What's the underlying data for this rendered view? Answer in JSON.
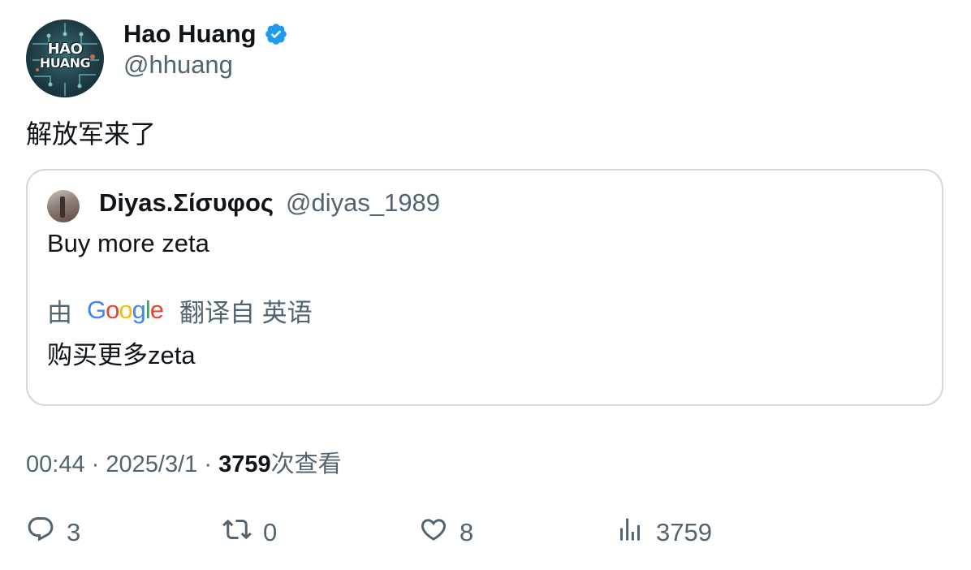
{
  "author": {
    "display_name": "Hao Huang",
    "handle": "@hhuang",
    "avatar_text": [
      "HAO",
      "HUANG"
    ],
    "verified": true
  },
  "tweet": {
    "text": "解放军来了"
  },
  "quoted_tweet": {
    "display_name": "Diyas.Σίσυφος",
    "handle": "@diyas_1989",
    "text": "Buy more zeta",
    "translation": {
      "prefix": "由",
      "provider": "Google",
      "suffix": "翻译自 英语",
      "text": "购买更多zeta"
    }
  },
  "meta": {
    "time": "00:44",
    "separator": "·",
    "date": "2025/3/1",
    "views_count": "3759",
    "views_label": "次查看"
  },
  "actions": {
    "replies": "3",
    "retweets": "0",
    "likes": "8",
    "views": "3759"
  },
  "colors": {
    "text_primary": "#0f1419",
    "text_secondary": "#536471",
    "border": "#cfd9de",
    "verified_blue": "#1d9bf0",
    "google_blue": "#4285F4",
    "google_red": "#EA4335",
    "google_yellow": "#FBBC05",
    "google_green": "#34A853"
  }
}
